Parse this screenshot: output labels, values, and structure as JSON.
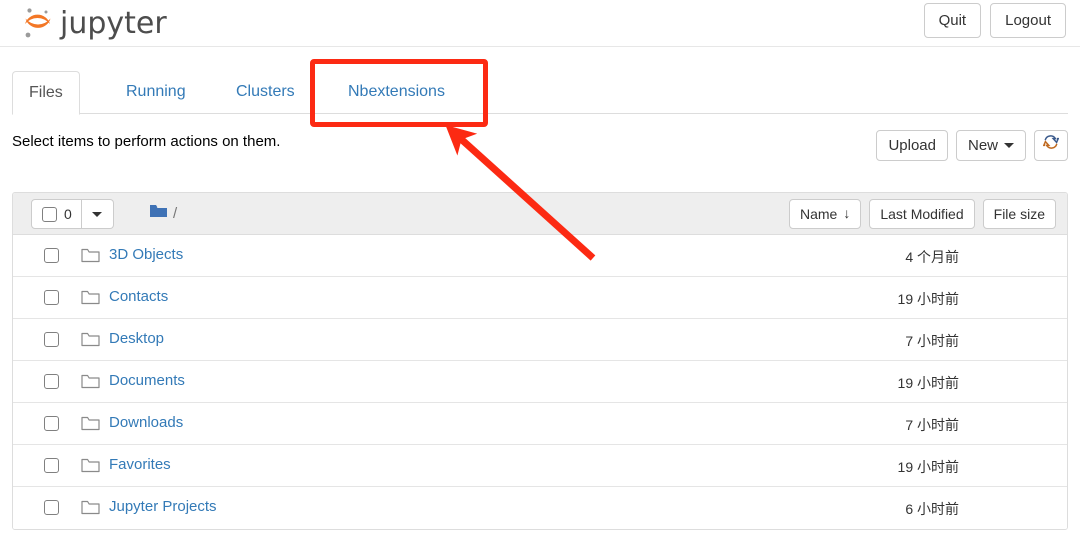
{
  "header": {
    "logo_text": "jupyter",
    "logo_icon": "jupyter-logo-icon",
    "buttons": [
      {
        "label": "Quit",
        "name": "quit-button"
      },
      {
        "label": "Logout",
        "name": "logout-button"
      }
    ]
  },
  "tabs": [
    {
      "label": "Files",
      "active": true
    },
    {
      "label": "Running",
      "active": false
    },
    {
      "label": "Clusters",
      "active": false
    },
    {
      "label": "Nbextensions",
      "active": false
    }
  ],
  "toolbar": {
    "note": "Select items to perform actions on them.",
    "upload_label": "Upload",
    "new_label": "New",
    "refresh_icon": "refresh-icon"
  },
  "list_header": {
    "select_count": "0",
    "select_caret_icon": "chevron-down-icon",
    "breadcrumb_folder_icon": "folder-filled-icon",
    "breadcrumb_path": "/",
    "sort_buttons": [
      {
        "label": "Name",
        "arrow": "↓",
        "name": "sort-name-button"
      },
      {
        "label": "Last Modified",
        "arrow": "",
        "name": "sort-last-modified-button"
      },
      {
        "label": "File size",
        "arrow": "",
        "name": "sort-file-size-button"
      }
    ]
  },
  "files": [
    {
      "name": "3D Objects",
      "modified": "4 个月前",
      "icon": "folder-icon"
    },
    {
      "name": "Contacts",
      "modified": "19 小时前",
      "icon": "folder-icon"
    },
    {
      "name": "Desktop",
      "modified": "7 小时前",
      "icon": "folder-icon"
    },
    {
      "name": "Documents",
      "modified": "19 小时前",
      "icon": "folder-icon"
    },
    {
      "name": "Downloads",
      "modified": "7 小时前",
      "icon": "folder-icon"
    },
    {
      "name": "Favorites",
      "modified": "19 小时前",
      "icon": "folder-icon"
    },
    {
      "name": "Jupyter Projects",
      "modified": "6 小时前",
      "icon": "folder-icon"
    }
  ],
  "annotations": {
    "highlight_target": "Nbextensions",
    "highlight_color": "#fc2a13",
    "arrow_color": "#fc2a13"
  },
  "colors": {
    "link": "#337ab7",
    "logo_orange": "#f37726",
    "header_band": "#eeeeee",
    "border": "#dddddd"
  }
}
